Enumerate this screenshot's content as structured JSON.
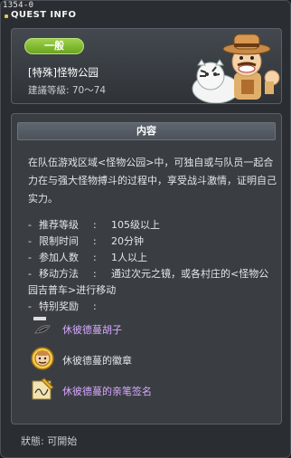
{
  "quest_id": "1354-0",
  "title": "QUEST INFO",
  "header": {
    "category": "一般",
    "quest_name": "[特殊]怪物公园",
    "required_level": "建議等級: 70～74"
  },
  "content": {
    "section_title": "内容",
    "description": "在队伍游戏区域<怪物公园>中，可独自或与队员一起合力在与强大怪物搏斗的过程中，享受战斗激情，证明自己实力。",
    "details": [
      {
        "label": "推荐等级",
        "value": "105级以上"
      },
      {
        "label": "限制时间",
        "value": "20分钟"
      },
      {
        "label": "参加人数",
        "value": "1人以上"
      },
      {
        "label": "移动方法",
        "value": "通过次元之镜，或各村庄的<怪物公"
      },
      {
        "continuation": "园吉普车>进行移动"
      },
      {
        "label": "特别奖励",
        "value": ""
      }
    ],
    "rewards": [
      {
        "name": "休彼德蔓胡子",
        "style": "special",
        "icon": "mustache-icon"
      },
      {
        "name": "休彼德蔓的徽章",
        "style": "normal",
        "icon": "medal-icon"
      },
      {
        "name": "休彼德蔓的亲笔签名",
        "style": "special",
        "icon": "autograph-icon"
      }
    ]
  },
  "status": "狀態:  可開始",
  "colors": {
    "accent_green": "#8cc63f",
    "special_item": "#d9a9ff",
    "background": "#2a2d31"
  }
}
